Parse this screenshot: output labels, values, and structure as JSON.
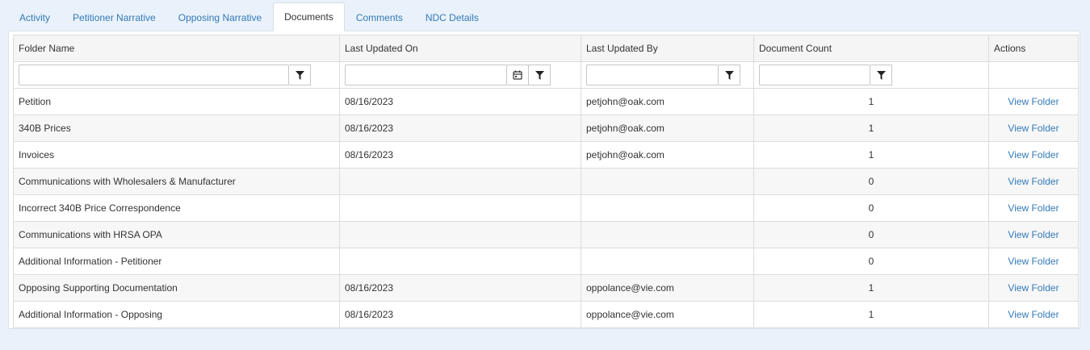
{
  "tabs": [
    {
      "label": "Activity",
      "active": false
    },
    {
      "label": "Petitioner Narrative",
      "active": false
    },
    {
      "label": "Opposing Narrative",
      "active": false
    },
    {
      "label": "Documents",
      "active": true
    },
    {
      "label": "Comments",
      "active": false
    },
    {
      "label": "NDC Details",
      "active": false
    }
  ],
  "grid": {
    "columns": [
      {
        "label": "Folder Name"
      },
      {
        "label": "Last Updated On"
      },
      {
        "label": "Last Updated By"
      },
      {
        "label": "Document Count"
      },
      {
        "label": "Actions"
      }
    ],
    "filters": {
      "folder_name": "",
      "last_updated_on": "",
      "last_updated_by": "",
      "document_count": ""
    },
    "rows": [
      {
        "folder": "Petition",
        "date": "08/16/2023",
        "by": "petjohn@oak.com",
        "count": "1",
        "action": "View Folder"
      },
      {
        "folder": "340B Prices",
        "date": "08/16/2023",
        "by": "petjohn@oak.com",
        "count": "1",
        "action": "View Folder"
      },
      {
        "folder": "Invoices",
        "date": "08/16/2023",
        "by": "petjohn@oak.com",
        "count": "1",
        "action": "View Folder"
      },
      {
        "folder": "Communications with Wholesalers & Manufacturer",
        "date": "",
        "by": "",
        "count": "0",
        "action": "View Folder"
      },
      {
        "folder": "Incorrect 340B Price Correspondence",
        "date": "",
        "by": "",
        "count": "0",
        "action": "View Folder"
      },
      {
        "folder": "Communications with HRSA OPA",
        "date": "",
        "by": "",
        "count": "0",
        "action": "View Folder"
      },
      {
        "folder": "Additional Information - Petitioner",
        "date": "",
        "by": "",
        "count": "0",
        "action": "View Folder"
      },
      {
        "folder": "Opposing Supporting Documentation",
        "date": "08/16/2023",
        "by": "oppolance@vie.com",
        "count": "1",
        "action": "View Folder"
      },
      {
        "folder": "Additional Information - Opposing",
        "date": "08/16/2023",
        "by": "oppolance@vie.com",
        "count": "1",
        "action": "View Folder"
      }
    ]
  },
  "icons": {
    "filter": "filter-icon",
    "calendar": "calendar-icon"
  },
  "colors": {
    "link": "#337ab7",
    "background": "#e9f1fa"
  }
}
